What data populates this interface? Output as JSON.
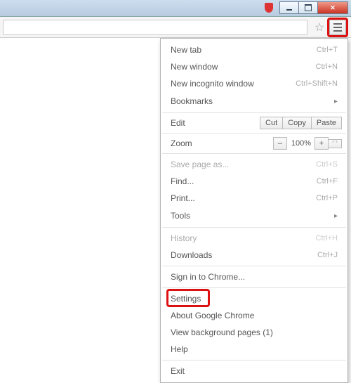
{
  "titlebar": {},
  "toolbar": {},
  "menu": {
    "newTab": {
      "label": "New tab",
      "shortcut": "Ctrl+T"
    },
    "newWindow": {
      "label": "New window",
      "shortcut": "Ctrl+N"
    },
    "incognito": {
      "label": "New incognito window",
      "shortcut": "Ctrl+Shift+N"
    },
    "bookmarks": {
      "label": "Bookmarks"
    },
    "edit": {
      "label": "Edit",
      "cut": "Cut",
      "copy": "Copy",
      "paste": "Paste"
    },
    "zoom": {
      "label": "Zoom",
      "minus": "–",
      "value": "100%",
      "plus": "+"
    },
    "savePage": {
      "label": "Save page as...",
      "shortcut": "Ctrl+S"
    },
    "find": {
      "label": "Find...",
      "shortcut": "Ctrl+F"
    },
    "print": {
      "label": "Print...",
      "shortcut": "Ctrl+P"
    },
    "tools": {
      "label": "Tools"
    },
    "history": {
      "label": "History",
      "shortcut": "Ctrl+H"
    },
    "downloads": {
      "label": "Downloads",
      "shortcut": "Ctrl+J"
    },
    "signIn": {
      "label": "Sign in to Chrome..."
    },
    "settings": {
      "label": "Settings"
    },
    "about": {
      "label": "About Google Chrome"
    },
    "bgPages": {
      "label": "View background pages (1)"
    },
    "help": {
      "label": "Help"
    },
    "exit": {
      "label": "Exit"
    }
  }
}
